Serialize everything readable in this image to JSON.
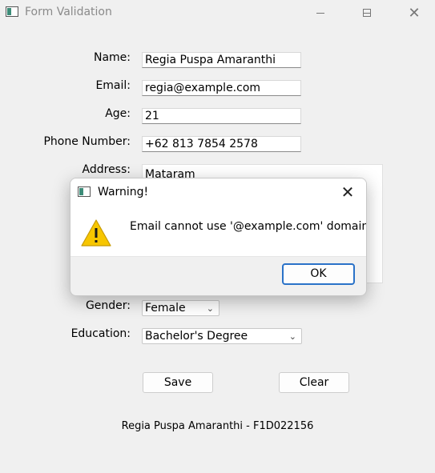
{
  "window": {
    "title": "Form Validation",
    "min_icon": "minimize-icon",
    "max_icon": "maximize-icon",
    "close_icon": "close-icon"
  },
  "form": {
    "name_label": "Name:",
    "name_value": "Regia Puspa Amaranthi",
    "email_label": "Email:",
    "email_value": "regia@example.com",
    "age_label": "Age:",
    "age_value": "21",
    "phone_label": "Phone Number:",
    "phone_value": "+62 813 7854 2578",
    "address_label": "Address:",
    "address_value": "Mataram",
    "gender_label": "Gender:",
    "gender_value": "Female",
    "education_label": "Education:",
    "education_value": "Bachelor's Degree",
    "save_label": "Save",
    "clear_label": "Clear"
  },
  "footer": {
    "text": "Regia Puspa Amaranthi - F1D022156"
  },
  "dialog": {
    "title": "Warning!",
    "message": "Email cannot use '@example.com' domain.",
    "ok_label": "OK",
    "icon": "warning-icon",
    "warning_color": "#f7c600"
  }
}
